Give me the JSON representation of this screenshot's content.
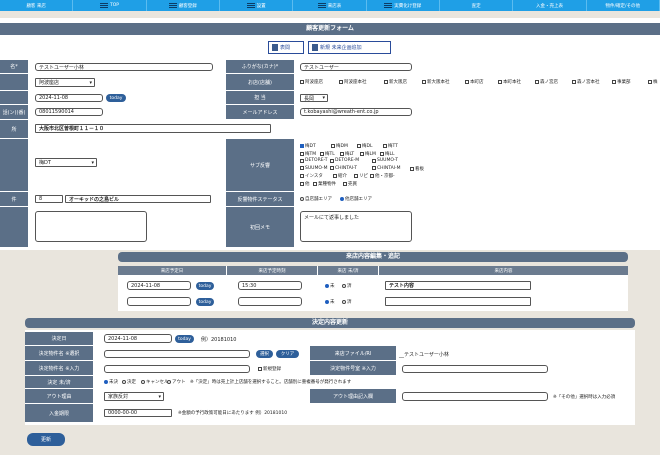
{
  "nav": [
    "顧客 来店",
    "TOP",
    "顧客登録",
    "設置",
    "来店表",
    "実費化け登録",
    "査定",
    "入金・売上表",
    "物件/確定/その他"
  ],
  "form": {
    "title": "顧客更新フォーム",
    "btn_list": "表間",
    "btn_campaign": "新規 未来企画追加",
    "name_label": "名*",
    "name_value": "テストユーザー小林",
    "kana_label": "ふりがな(カナ)*",
    "kana_value": "テストユーザー",
    "store_label": "お店(店舗)",
    "store_value": "阿波座店",
    "date_value": "2024-11-08",
    "today_label": "today",
    "staff_label": "担 当",
    "staff_value": "長岡",
    "phone_label": "話(ン)(番)",
    "phone_value": "08011590014",
    "email_label": "メールアドレス",
    "email_value": "t.kobayashi@wreath-ent.co.jp",
    "address_label": "所",
    "address_value": "大阪市北区曽根町１１－１０",
    "type_value": "梅DT",
    "subarea_label": "サブ反響",
    "building_label": "件",
    "building_no": "8",
    "building_name": "オーキッドの之島ビル",
    "status_label": "反響物件ステータス",
    "memo_label": "初回メモ",
    "memo_value": "メールにて返事しました"
  },
  "stores": [
    "阿波座店",
    "阿波座本社",
    "新大阪店",
    "新大阪本社",
    "本町店",
    "本町本社",
    "森ノ宮店",
    "森ノ宮本社",
    "事業部",
    "株"
  ],
  "subareas": [
    "梅DT",
    "梅DM",
    "梅DL",
    "梅TT",
    "梅TM",
    "梅TL",
    "梅LT",
    "梅LM",
    "梅LL",
    "DETORE-T",
    "DETORE-M",
    "SUUMO-T",
    "SUUMO-M",
    "CHINTAI-T",
    "CHINTAI-M",
    "看板",
    "インスタ",
    "紹介",
    "リピ",
    "他・京都-",
    "他",
    "業種物件",
    "売買"
  ],
  "status_opts": [
    "自店舗エリア",
    "他店舗エリア"
  ],
  "visit": {
    "title": "来店内容編集・追記",
    "col_date": "来店予定日",
    "col_time": "来店予定時刻",
    "col_status": "来店 未/済",
    "col_content": "来店内容",
    "date": "2024-11-08",
    "today": "today",
    "time": "15:30",
    "st_not": "未",
    "st_done": "済",
    "content": "テスト内容"
  },
  "decision": {
    "title": "決定内容更新",
    "date_label": "決定日",
    "date_value": "2024-11-08",
    "today": "today",
    "date_example": "例）20181010",
    "prop_name_label": "決定物件名",
    "prop_select_note": "※選択",
    "select_btn": "選択",
    "clear_btn": "クリア",
    "file_label": "来店ファイル/Rl",
    "file_value": "テストユーザー小林",
    "prop_name2_label": "決定物件名",
    "input_note": "※入力",
    "new_reg": "新規登録",
    "room_label": "決定物件号室",
    "room_note": "※入力",
    "status_label": "決定 未/済",
    "status_opts": [
      "未決",
      "決定",
      "キャンセル",
      "アウト"
    ],
    "status_note": "※「決定」時は売上計上店舗を選択すること。店舗別に重複番号が発行されます",
    "reason_label": "アウト理由",
    "reason_value": "家族反対",
    "reason_input_label": "アウト理由記入欄",
    "reason_note": "※「その他」選択時は入力必須",
    "payment_label": "入金期限",
    "payment_value": "0000-00-00",
    "payment_note": "※金額の予行政策可能日にあたります 例）20181010",
    "update_btn": "更新"
  }
}
